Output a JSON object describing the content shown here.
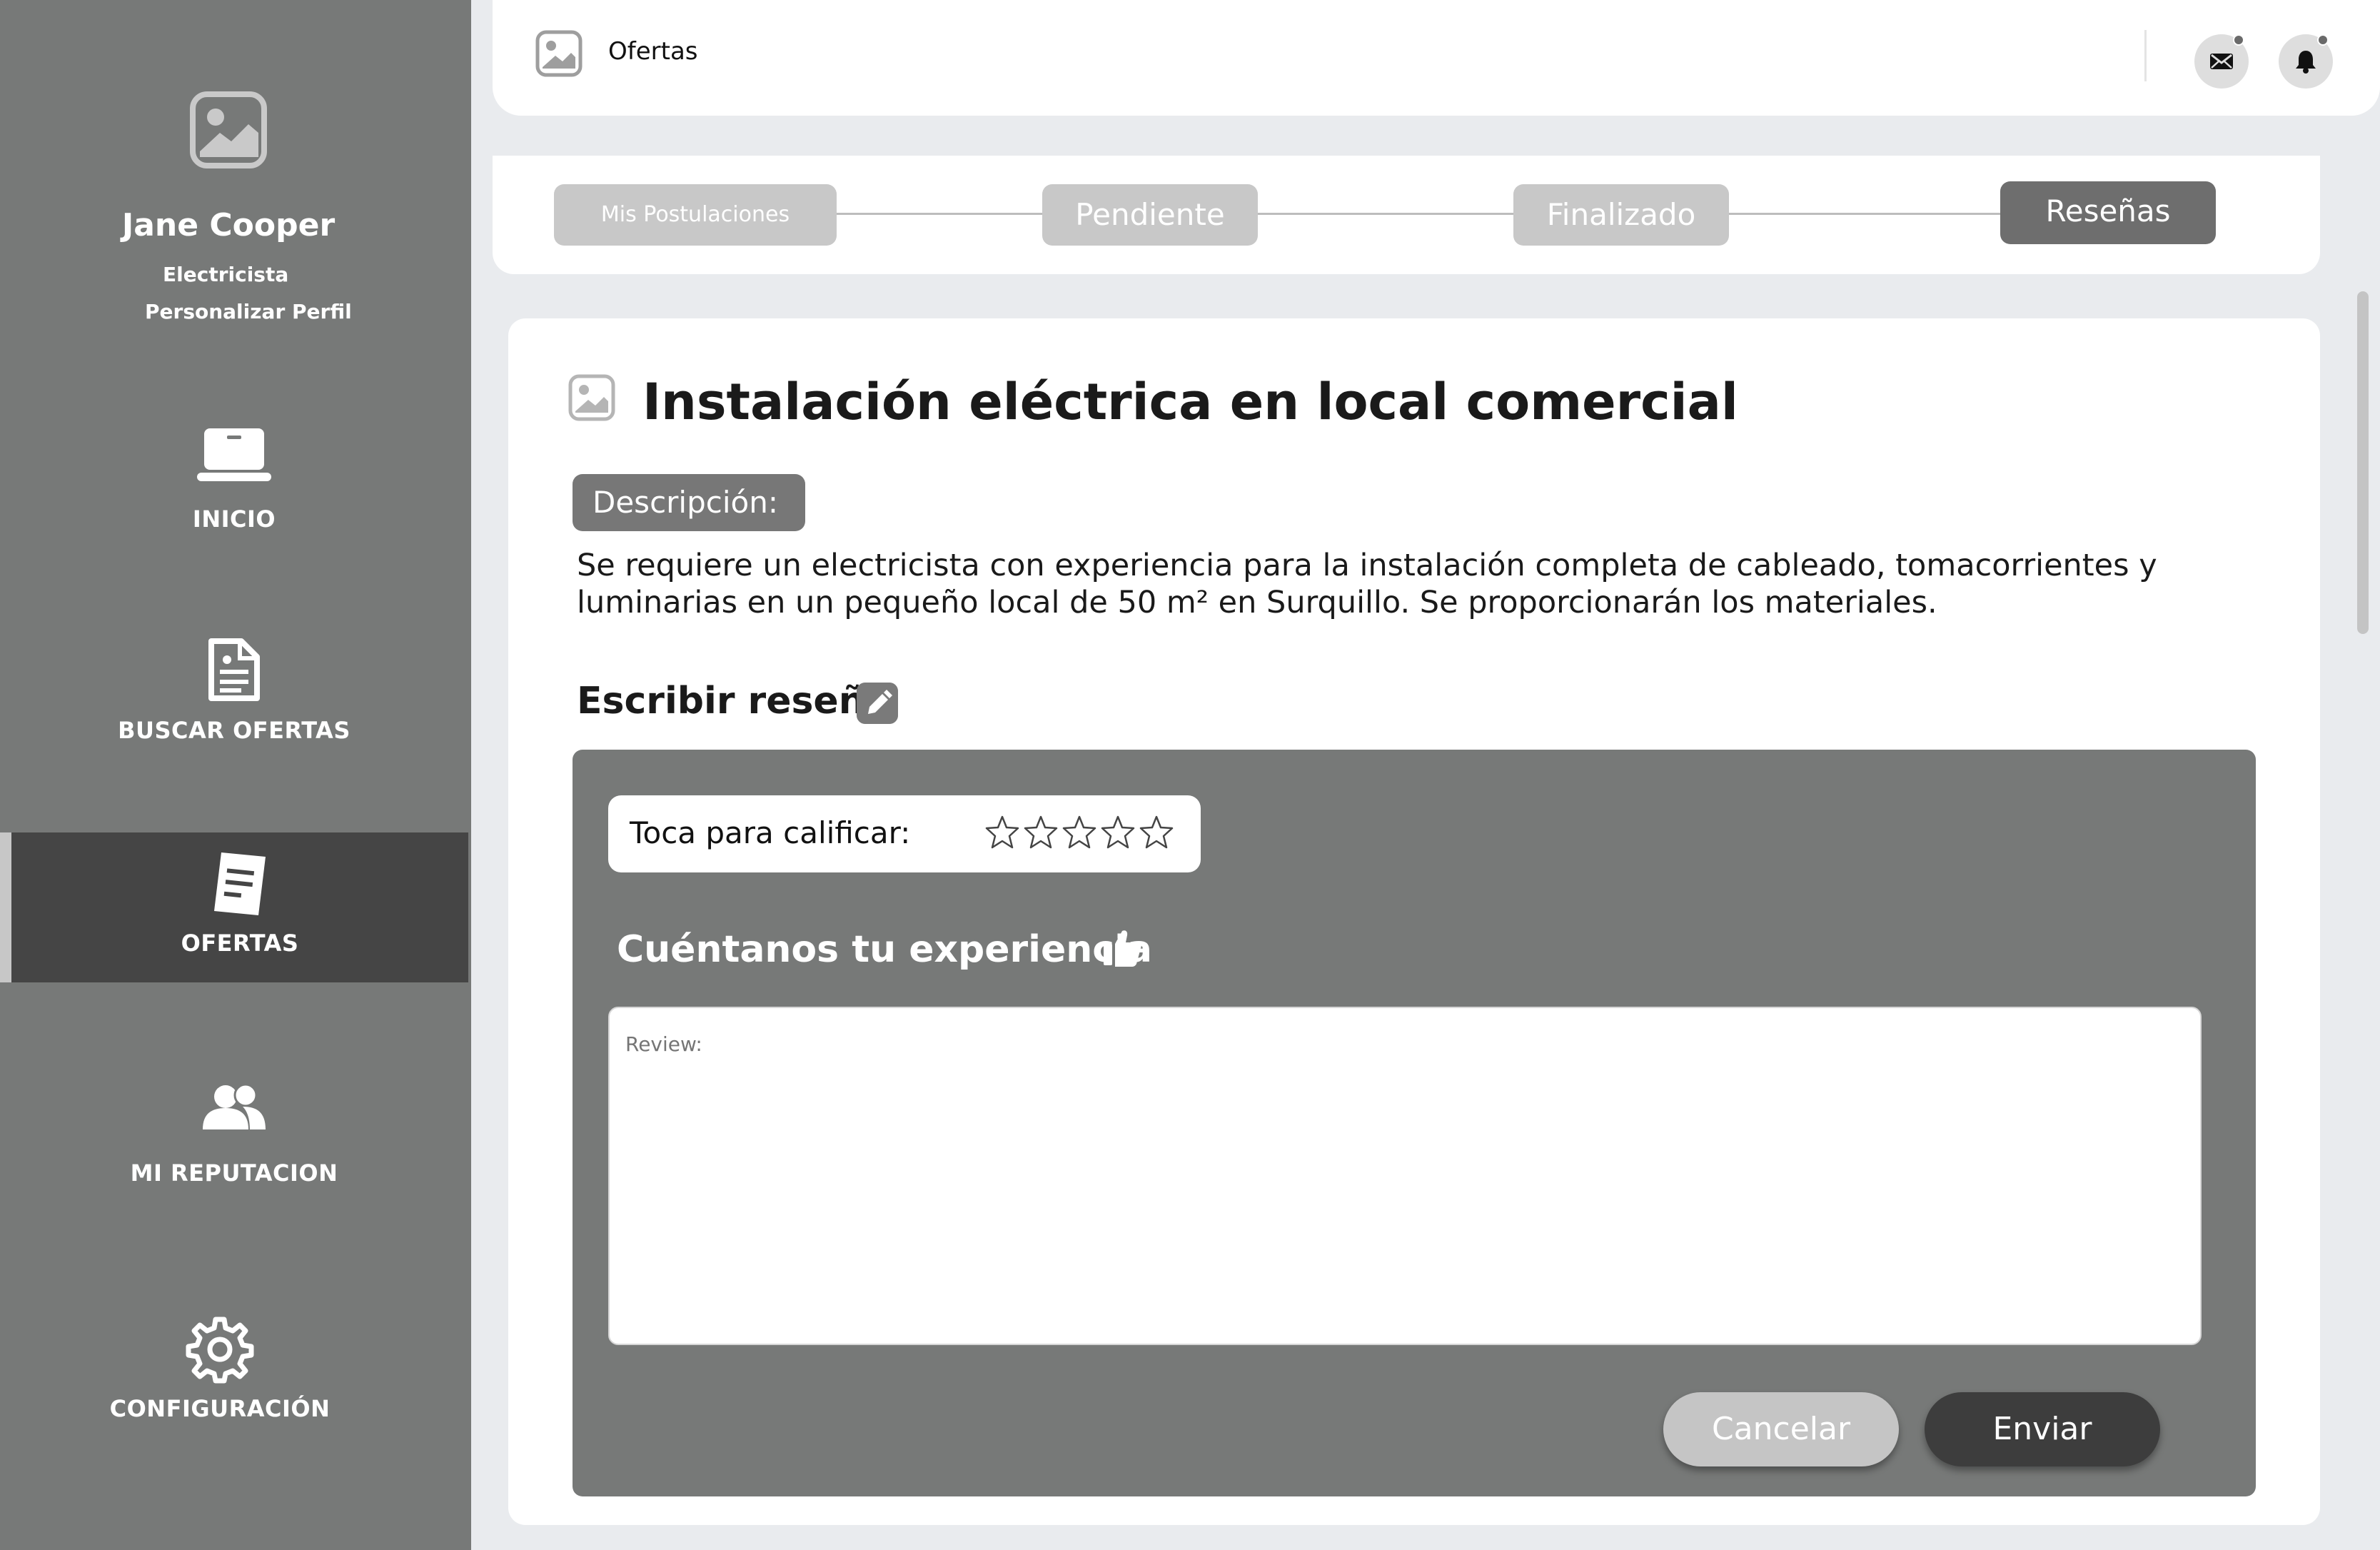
{
  "sidebar": {
    "profile": {
      "name": "Jane Cooper",
      "role": "Electricista",
      "edit_link": "Personalizar Perfil"
    },
    "items": [
      {
        "label": "INICIO",
        "icon": "laptop-icon"
      },
      {
        "label": "BUSCAR OFERTAS",
        "icon": "document-icon"
      },
      {
        "label": "OFERTAS",
        "icon": "note-icon",
        "active": true
      },
      {
        "label": "MI REPUTACION",
        "icon": "users-icon"
      },
      {
        "label": "CONFIGURACIÓN",
        "icon": "gear-icon"
      }
    ]
  },
  "topbar": {
    "title": "Ofertas",
    "icons": [
      "image-icon",
      "mail-icon",
      "bell-icon"
    ]
  },
  "stepper": {
    "steps": [
      {
        "label": "Mis Postulaciones"
      },
      {
        "label": "Pendiente"
      },
      {
        "label": "Finalizado"
      },
      {
        "label": "Reseñas",
        "active": true
      }
    ]
  },
  "offer": {
    "title": "Instalación eléctrica en local comercial",
    "description_label": "Descripción:",
    "description": "Se requiere un electricista con experiencia para la instalación completa de cableado, tomacorrientes y luminarias en un pequeño local de 50 m² en Surquillo. Se proporcionarán los materiales."
  },
  "review": {
    "heading": "Escribir reseña",
    "rating_label": "Toca para calificar:",
    "rating_value": 0,
    "rating_max": 5,
    "experience_heading": "Cuéntanos tu experiencia",
    "field_placeholder": "Review:",
    "cancel_label": "Cancelar",
    "send_label": "Enviar"
  },
  "colors": {
    "sidebar": "#777978",
    "active_nav": "#454545",
    "accent_dark": "#3d3d3d",
    "step_inactive": "#c8c8c8",
    "step_active": "#6e6e6e"
  }
}
